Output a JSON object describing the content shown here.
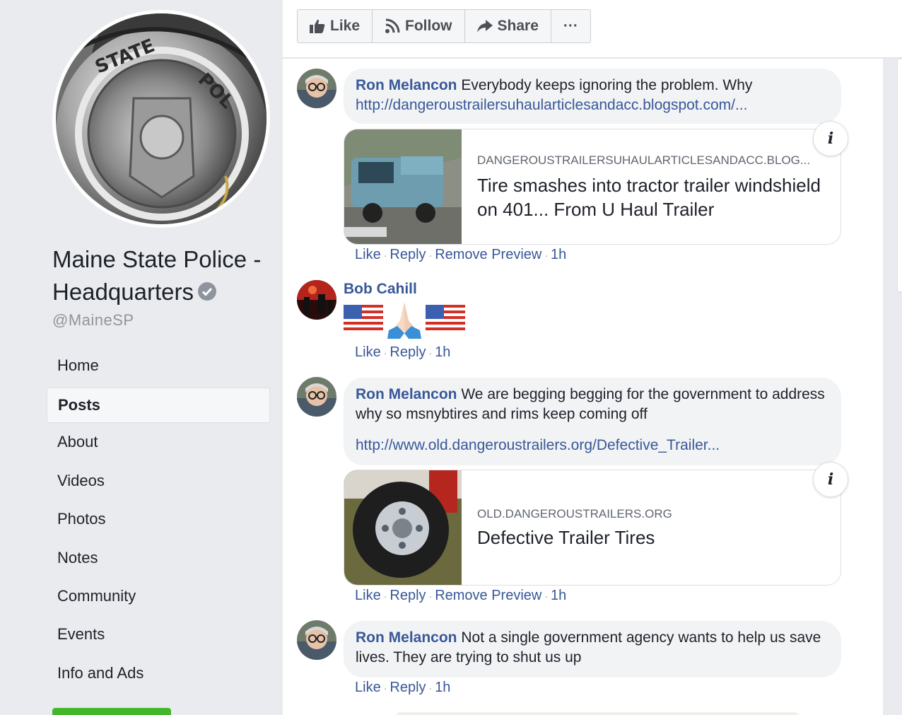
{
  "page": {
    "name": "Maine State Police - Headquarters",
    "handle": "@MaineSP",
    "verified_icon": "verified-badge-icon"
  },
  "nav": {
    "items": [
      {
        "label": "Home",
        "active": false
      },
      {
        "label": "Posts",
        "active": true
      },
      {
        "label": "About",
        "active": false
      },
      {
        "label": "Videos",
        "active": false
      },
      {
        "label": "Photos",
        "active": false
      },
      {
        "label": "Notes",
        "active": false
      },
      {
        "label": "Community",
        "active": false
      },
      {
        "label": "Events",
        "active": false
      },
      {
        "label": "Info and Ads",
        "active": false
      }
    ]
  },
  "toolbar": {
    "like_label": "Like",
    "follow_label": "Follow",
    "share_label": "Share",
    "more_label": "···"
  },
  "comments": [
    {
      "author": "Ron Melancon",
      "text": "Everybody keeps ignoring the problem. Why",
      "link": "http://dangeroustrailersuhaularticlesandacc.blogspot.com/...",
      "preview": {
        "domain": "DANGEROUSTRAILERSUHAULARTICLESANDACC.BLOG...",
        "title": "Tire smashes into tractor trailer windshield on 401... From U Haul Trailer"
      },
      "actions": {
        "like": "Like",
        "reply": "Reply",
        "remove": "Remove Preview",
        "time": "1h"
      }
    },
    {
      "author": "Bob Cahill",
      "emojis": [
        "🇺🇸",
        "🙏",
        "🇺🇸"
      ],
      "actions": {
        "like": "Like",
        "reply": "Reply",
        "time": "1h"
      }
    },
    {
      "author": "Ron Melancon",
      "text": "We are begging begging for the government to address why so msnybtires and rims keep coming off",
      "link": "http://www.old.dangeroustrailers.org/Defective_Trailer...",
      "preview": {
        "domain": "OLD.DANGEROUSTRAILERS.ORG",
        "title": "Defective Trailer Tires"
      },
      "actions": {
        "like": "Like",
        "reply": "Reply",
        "remove": "Remove Preview",
        "time": "1h"
      }
    },
    {
      "author": "Ron Melancon",
      "text": "Not a single government agency wants to help us save lives. They are trying to shut us up",
      "actions": {
        "like": "Like",
        "reply": "Reply",
        "time": "1h"
      }
    }
  ],
  "colors": {
    "link_blue": "#385898",
    "bubble_gray": "#f2f3f5",
    "page_bg": "#e9ebee",
    "meta_gray": "#90949c"
  }
}
